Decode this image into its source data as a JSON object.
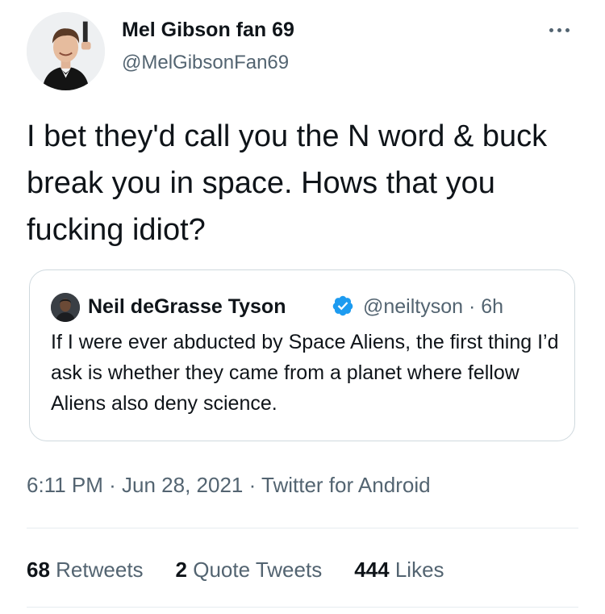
{
  "tweet": {
    "author": {
      "display_name": "Mel Gibson fan 69",
      "handle": "@MelGibsonFan69"
    },
    "text": "I bet they'd call you the N word & buck break you in space. Hows that you fucking idiot?",
    "quoted_tweet": {
      "author_name": "Neil deGrasse Tyson",
      "verified": true,
      "handle": "@neiltyson",
      "age": "6h",
      "text": "If I were ever abducted by Space Aliens, the first thing I’d ask is whether they came from a planet where fellow Aliens also deny science."
    },
    "time": "6:11 PM",
    "date": "Jun 28, 2021",
    "source": "Twitter for Android",
    "stats": {
      "retweets_count": "68",
      "retweets_label": "Retweets",
      "quote_tweets_count": "2",
      "quote_tweets_label": "Quote Tweets",
      "likes_count": "444",
      "likes_label": "Likes"
    }
  },
  "icons": {
    "more": "more-options-icon",
    "verified": "verified-badge-icon"
  },
  "colors": {
    "text_primary": "#0f1419",
    "text_secondary": "#536471",
    "border": "#cfd9de",
    "verified_blue": "#1d9bf0"
  }
}
